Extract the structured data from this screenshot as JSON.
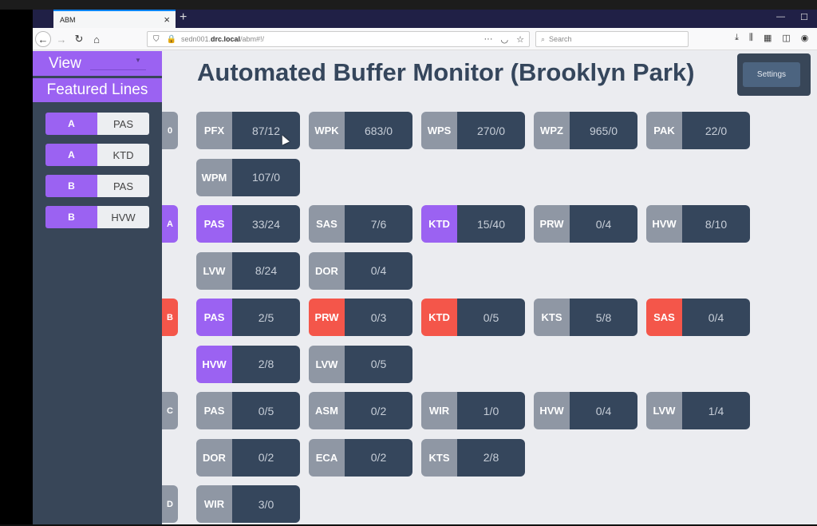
{
  "browser": {
    "tab_title": "ABM",
    "tab_close": "×",
    "new_tab": "+",
    "minimize": "—",
    "maximize": "☐",
    "url_prefix": "sedn001.",
    "url_domain": "drc.local",
    "url_path": "/abm#!/",
    "search_placeholder": "Search",
    "icons": {
      "back": "←",
      "forward": "→",
      "reload": "↻",
      "home": "⌂",
      "shield": "⛉",
      "insecure": "🔒",
      "more": "···",
      "pocket": "◡",
      "star": "☆",
      "search": "⌕",
      "download": "⤓",
      "library": "⫼",
      "extensions": "▦",
      "sidebar": "◫",
      "account": "◉"
    }
  },
  "sidebar": {
    "view_label": "View",
    "view_caret": "▼",
    "featured_header": "Featured Lines",
    "featured": [
      {
        "code": "A",
        "station": "PAS"
      },
      {
        "code": "A",
        "station": "KTD"
      },
      {
        "code": "B",
        "station": "PAS"
      },
      {
        "code": "B",
        "station": "HVW"
      }
    ]
  },
  "main": {
    "title": "Automated Buffer Monitor (Brooklyn Park)",
    "settings_label": "Settings",
    "colors": {
      "neutral": "#8f97a4",
      "featured": "#9b62f2",
      "alert": "#f4564a",
      "value_bg": "#35465c"
    },
    "rows": [
      {
        "label": "0",
        "status": "neutral",
        "cards": [
          {
            "station": "PFX",
            "value": "87/12",
            "status": "neutral"
          },
          {
            "station": "WPK",
            "value": "683/0",
            "status": "neutral"
          },
          {
            "station": "WPS",
            "value": "270/0",
            "status": "neutral"
          },
          {
            "station": "WPZ",
            "value": "965/0",
            "status": "neutral"
          },
          {
            "station": "PAK",
            "value": "22/0",
            "status": "neutral"
          },
          {
            "station": "WPM",
            "value": "107/0",
            "status": "neutral"
          }
        ]
      },
      {
        "label": "A",
        "status": "featured",
        "cards": [
          {
            "station": "PAS",
            "value": "33/24",
            "status": "featured"
          },
          {
            "station": "SAS",
            "value": "7/6",
            "status": "neutral"
          },
          {
            "station": "KTD",
            "value": "15/40",
            "status": "featured"
          },
          {
            "station": "PRW",
            "value": "0/4",
            "status": "neutral"
          },
          {
            "station": "HVW",
            "value": "8/10",
            "status": "neutral"
          },
          {
            "station": "LVW",
            "value": "8/24",
            "status": "neutral"
          },
          {
            "station": "DOR",
            "value": "0/4",
            "status": "neutral"
          }
        ]
      },
      {
        "label": "B",
        "status": "alert",
        "cards": [
          {
            "station": "PAS",
            "value": "2/5",
            "status": "featured"
          },
          {
            "station": "PRW",
            "value": "0/3",
            "status": "alert"
          },
          {
            "station": "KTD",
            "value": "0/5",
            "status": "alert"
          },
          {
            "station": "KTS",
            "value": "5/8",
            "status": "neutral"
          },
          {
            "station": "SAS",
            "value": "0/4",
            "status": "alert"
          },
          {
            "station": "HVW",
            "value": "2/8",
            "status": "featured"
          },
          {
            "station": "LVW",
            "value": "0/5",
            "status": "neutral"
          }
        ]
      },
      {
        "label": "C",
        "status": "neutral",
        "cards": [
          {
            "station": "PAS",
            "value": "0/5",
            "status": "neutral"
          },
          {
            "station": "ASM",
            "value": "0/2",
            "status": "neutral"
          },
          {
            "station": "WIR",
            "value": "1/0",
            "status": "neutral"
          },
          {
            "station": "HVW",
            "value": "0/4",
            "status": "neutral"
          },
          {
            "station": "LVW",
            "value": "1/4",
            "status": "neutral"
          },
          {
            "station": "DOR",
            "value": "0/2",
            "status": "neutral"
          },
          {
            "station": "ECA",
            "value": "0/2",
            "status": "neutral"
          },
          {
            "station": "KTS",
            "value": "2/8",
            "status": "neutral"
          }
        ]
      },
      {
        "label": "D",
        "status": "neutral",
        "cards": [
          {
            "station": "WIR",
            "value": "3/0",
            "status": "neutral"
          }
        ]
      }
    ]
  }
}
